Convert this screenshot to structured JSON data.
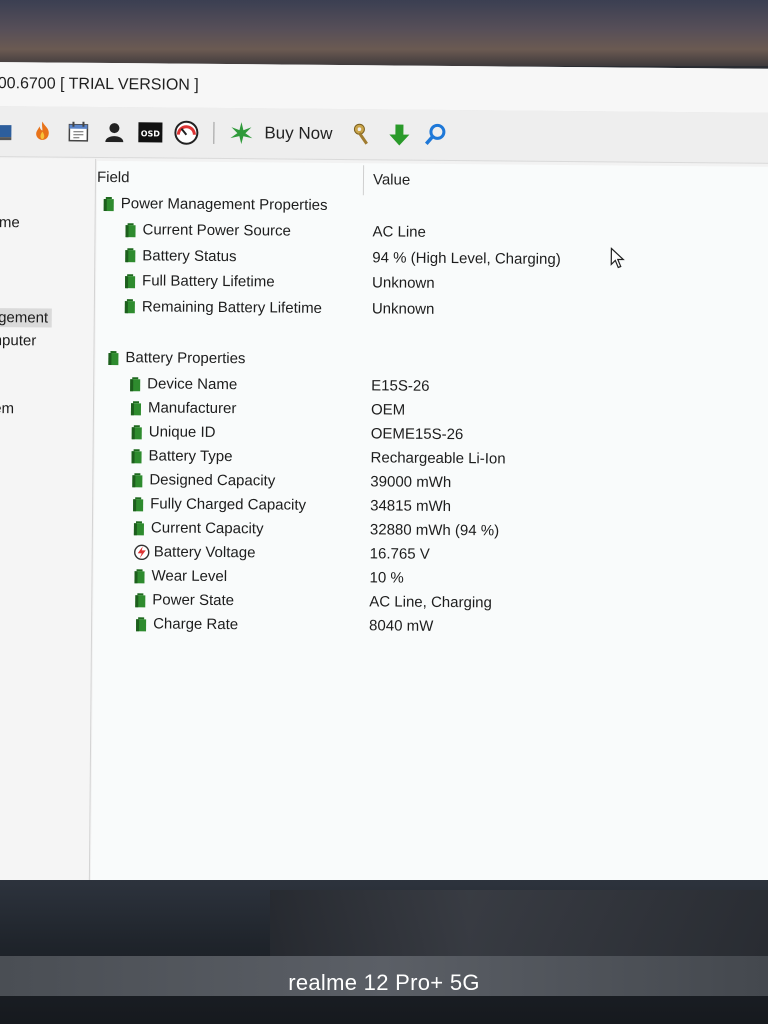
{
  "window": {
    "title": "00.6700  [ TRIAL VERSION ]"
  },
  "toolbar": {
    "icons": [
      "network-icon",
      "flame-icon",
      "calendar-icon",
      "user-icon",
      "osd-icon",
      "gauge-icon",
      "star-burst-icon",
      "key-icon",
      "download-arrow-icon",
      "search-icon"
    ],
    "buy_now_label": "Buy Now"
  },
  "sidebar": {
    "items": [
      {
        "label": "ame"
      },
      {
        "label": "agement"
      },
      {
        "label": "mputer"
      },
      {
        "label": "tem"
      }
    ]
  },
  "list": {
    "header_field": "Field",
    "header_value": "Value",
    "sections": [
      {
        "label": "Power Management Properties",
        "rows": [
          {
            "field": "Current Power Source",
            "value": "AC Line"
          },
          {
            "field": "Battery Status",
            "value": "94 % (High Level, Charging)"
          },
          {
            "field": "Full Battery Lifetime",
            "value": "Unknown"
          },
          {
            "field": "Remaining Battery Lifetime",
            "value": "Unknown"
          }
        ]
      },
      {
        "label": "Battery Properties",
        "rows": [
          {
            "field": "Device Name",
            "value": "E15S-26"
          },
          {
            "field": "Manufacturer",
            "value": "OEM"
          },
          {
            "field": "Unique ID",
            "value": "OEME15S-26"
          },
          {
            "field": "Battery Type",
            "value": "Rechargeable Li-Ion"
          },
          {
            "field": "Designed Capacity",
            "value": "39000 mWh"
          },
          {
            "field": "Fully Charged Capacity",
            "value": "34815 mWh"
          },
          {
            "field": "Current Capacity",
            "value": "32880 mWh  (94 %)"
          },
          {
            "field": "Battery Voltage",
            "value": "16.765 V"
          },
          {
            "field": "Wear Level",
            "value": "10 %"
          },
          {
            "field": "Power State",
            "value": "AC Line, Charging"
          },
          {
            "field": "Charge Rate",
            "value": "8040 mW"
          }
        ]
      }
    ]
  },
  "colors": {
    "battery_icon_green": "#2e8b2e",
    "download_arrow_green": "#2a9a2a",
    "search_blue": "#1e78d8",
    "flame_orange": "#e8731a"
  },
  "photo": {
    "watermark": "realme 12 Pro+ 5G"
  }
}
